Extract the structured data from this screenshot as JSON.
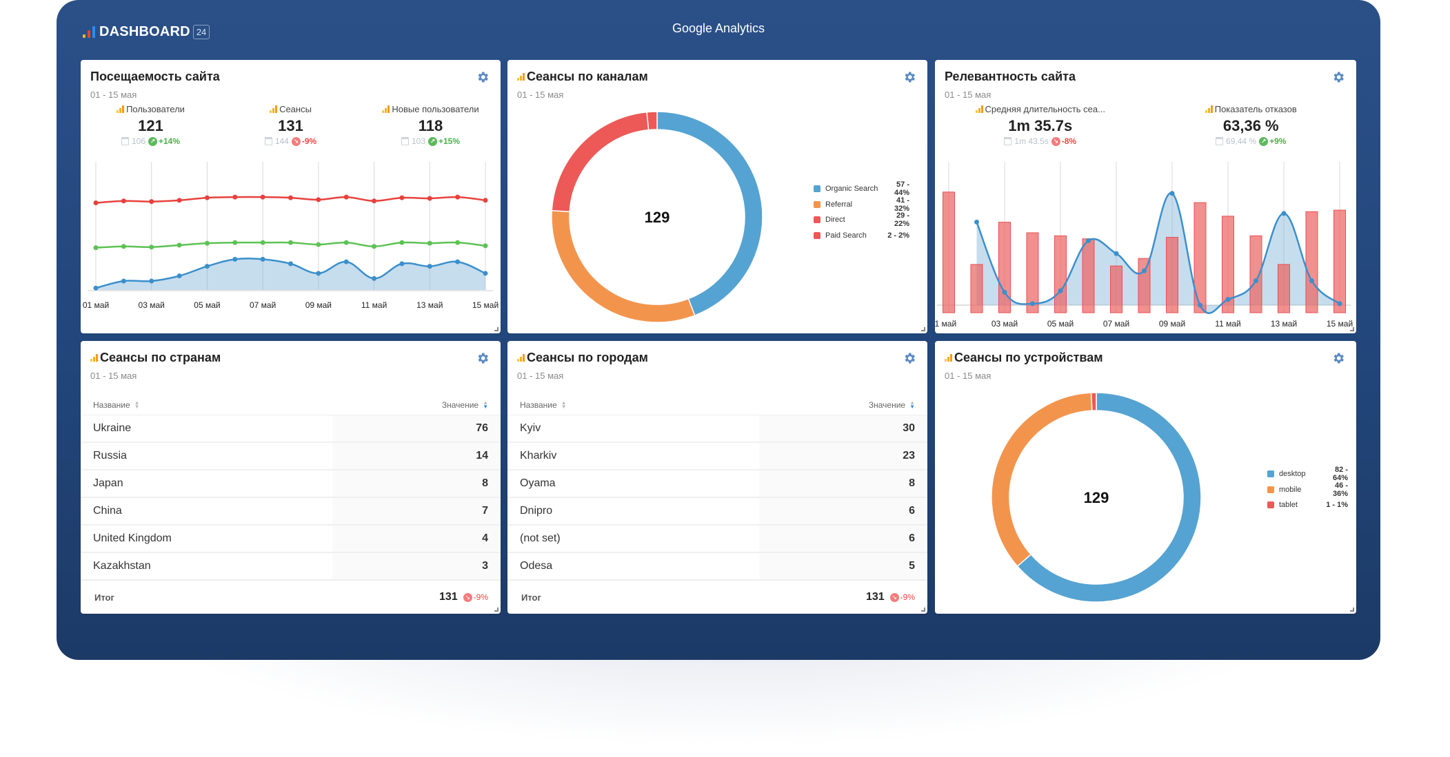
{
  "app": {
    "brand": "DASHBOARD",
    "brand_badge": "24",
    "title": "Google Analytics"
  },
  "colors": {
    "frame": "#264a80",
    "blue": "#55a3d2",
    "orange": "#f3944d",
    "red": "#ec5957",
    "green": "#5cb85c",
    "gear": "#5b8ac2"
  },
  "icons": {
    "settings": "gear-icon",
    "calendar": "calendar-icon",
    "trend_up": "trend-up-icon",
    "trend_down": "trend-down-icon",
    "source": "google-analytics-icon",
    "sort": "sort-icon",
    "resize": "resize-handle-icon"
  },
  "cards": {
    "traffic": {
      "title": "Посещаемость сайта",
      "date_range": "01 - 15 мая",
      "kpis": [
        {
          "label": "Пользователи",
          "value": "121",
          "prev": "106",
          "delta": "+14%",
          "trend": "up"
        },
        {
          "label": "Сеансы",
          "value": "131",
          "prev": "144",
          "delta": "-9%",
          "trend": "down"
        },
        {
          "label": "Новые пользователи",
          "value": "118",
          "prev": "103",
          "delta": "+15%",
          "trend": "up"
        }
      ]
    },
    "channels": {
      "title": "Сеансы по каналам",
      "date_range": "01 - 15 мая",
      "total": "129"
    },
    "relevance": {
      "title": "Релевантность сайта",
      "date_range": "01 - 15 мая",
      "kpis": [
        {
          "label": "Средняя длительность сеа...",
          "value": "1m 35.7s",
          "prev": "1m 43.5s",
          "delta": "-8%",
          "trend": "down"
        },
        {
          "label": "Показатель отказов",
          "value": "63,36 %",
          "prev": "69,44 %",
          "delta": "+9%",
          "trend": "up"
        }
      ]
    },
    "countries": {
      "title": "Сеансы по странам",
      "date_range": "01 - 15 мая",
      "columns": [
        "Название",
        "Значение"
      ],
      "rows": [
        {
          "name": "Ukraine",
          "value": "76"
        },
        {
          "name": "Russia",
          "value": "14"
        },
        {
          "name": "Japan",
          "value": "8"
        },
        {
          "name": "China",
          "value": "7"
        },
        {
          "name": "United Kingdom",
          "value": "4"
        },
        {
          "name": "Kazakhstan",
          "value": "3"
        }
      ],
      "total_label": "Итог",
      "total": "131",
      "total_delta": "-9%"
    },
    "cities": {
      "title": "Сеансы по городам",
      "date_range": "01 - 15 мая",
      "columns": [
        "Название",
        "Значение"
      ],
      "rows": [
        {
          "name": "Kyiv",
          "value": "30"
        },
        {
          "name": "Kharkiv",
          "value": "23"
        },
        {
          "name": "Oyama",
          "value": "8"
        },
        {
          "name": "Dnipro",
          "value": "6"
        },
        {
          "name": "(not set)",
          "value": "6"
        },
        {
          "name": "Odesa",
          "value": "5"
        }
      ],
      "total_label": "Итог",
      "total": "131",
      "total_delta": "-9%"
    },
    "devices": {
      "title": "Сеансы по устройствам",
      "date_range": "01 - 15 мая",
      "total": "129"
    }
  },
  "chart_data": [
    {
      "id": "traffic",
      "type": "line",
      "title": "Посещаемость сайта",
      "x": [
        "01 май",
        "02 май",
        "03 май",
        "04 май",
        "05 май",
        "06 май",
        "07 май",
        "08 май",
        "09 май",
        "10 май",
        "11 май",
        "12 май",
        "13 май",
        "14 май",
        "15 май"
      ],
      "xtick_labels": [
        "01 май",
        "03 май",
        "05 май",
        "07 май",
        "09 май",
        "11 май",
        "13 май",
        "15 май"
      ],
      "ylim": [
        0,
        20
      ],
      "grid": "vertical",
      "series": [
        {
          "name": "Сеансы",
          "color": "#e8413c",
          "values": [
            13.6,
            13.9,
            13.8,
            14.0,
            14.4,
            14.5,
            14.5,
            14.4,
            14.1,
            14.5,
            13.9,
            14.4,
            14.3,
            14.5,
            14.0
          ]
        },
        {
          "name": "Пользователи",
          "color": "#5cc253",
          "values": [
            6.6,
            6.8,
            6.7,
            7.0,
            7.3,
            7.4,
            7.4,
            7.4,
            7.1,
            7.4,
            6.8,
            7.4,
            7.3,
            7.4,
            6.9
          ]
        },
        {
          "name": "Новые пользователи",
          "color": "#3b8fcc",
          "area": true,
          "values": [
            0.3,
            1.4,
            1.4,
            2.2,
            3.7,
            4.8,
            4.8,
            4.1,
            2.6,
            4.4,
            1.8,
            4.1,
            3.7,
            4.4,
            2.6
          ]
        }
      ]
    },
    {
      "id": "channels",
      "type": "pie",
      "donut": true,
      "center_label": "129",
      "legend_position": "right",
      "slices": [
        {
          "label": "Organic Search",
          "value": 57,
          "percent": 44,
          "display": "57 - 44%",
          "color": "#55a3d2"
        },
        {
          "label": "Referral",
          "value": 41,
          "percent": 32,
          "display": "41 - 32%",
          "color": "#f3944d"
        },
        {
          "label": "Direct",
          "value": 29,
          "percent": 22,
          "display": "29 - 22%",
          "color": "#ec5957"
        },
        {
          "label": "Paid Search",
          "value": 2,
          "percent": 2,
          "display": "2 - 2%",
          "color": "#ec5957"
        }
      ]
    },
    {
      "id": "relevance",
      "type": "bar",
      "title": "Релевантность сайта",
      "x": [
        "01 май",
        "02 май",
        "03 май",
        "04 май",
        "05 май",
        "06 май",
        "07 май",
        "08 май",
        "09 май",
        "10 май",
        "11 май",
        "12 май",
        "13 май",
        "14 май",
        "15 май"
      ],
      "xtick_labels": [
        "01 май",
        "03 май",
        "05 май",
        "07 май",
        "09 май",
        "11 май",
        "13 май",
        "15 май"
      ],
      "grid": "vertical",
      "series": [
        {
          "name": "Показатель отказов",
          "type": "bar",
          "color": "#f08080",
          "ylim": [
            0,
            100
          ],
          "values": [
            80,
            32,
            60,
            53,
            51,
            49,
            31,
            36,
            50,
            73,
            64,
            51,
            32,
            67,
            68
          ]
        },
        {
          "name": "Средняя длительность сеанса",
          "type": "area-line",
          "color": "#3b8fcc",
          "ylim": [
            0,
            100
          ],
          "values": [
            null,
            58,
            9,
            1,
            10,
            45,
            36,
            24,
            78,
            0,
            4,
            17,
            64,
            17,
            1
          ]
        }
      ]
    },
    {
      "id": "devices",
      "type": "pie",
      "donut": true,
      "center_label": "129",
      "legend_position": "right",
      "slices": [
        {
          "label": "desktop",
          "value": 82,
          "percent": 64,
          "display": "82 - 64%",
          "color": "#55a3d2"
        },
        {
          "label": "mobile",
          "value": 46,
          "percent": 36,
          "display": "46 - 36%",
          "color": "#f3944d"
        },
        {
          "label": "tablet",
          "value": 1,
          "percent": 1,
          "display": "1 - 1%",
          "color": "#ec5957"
        }
      ]
    }
  ]
}
